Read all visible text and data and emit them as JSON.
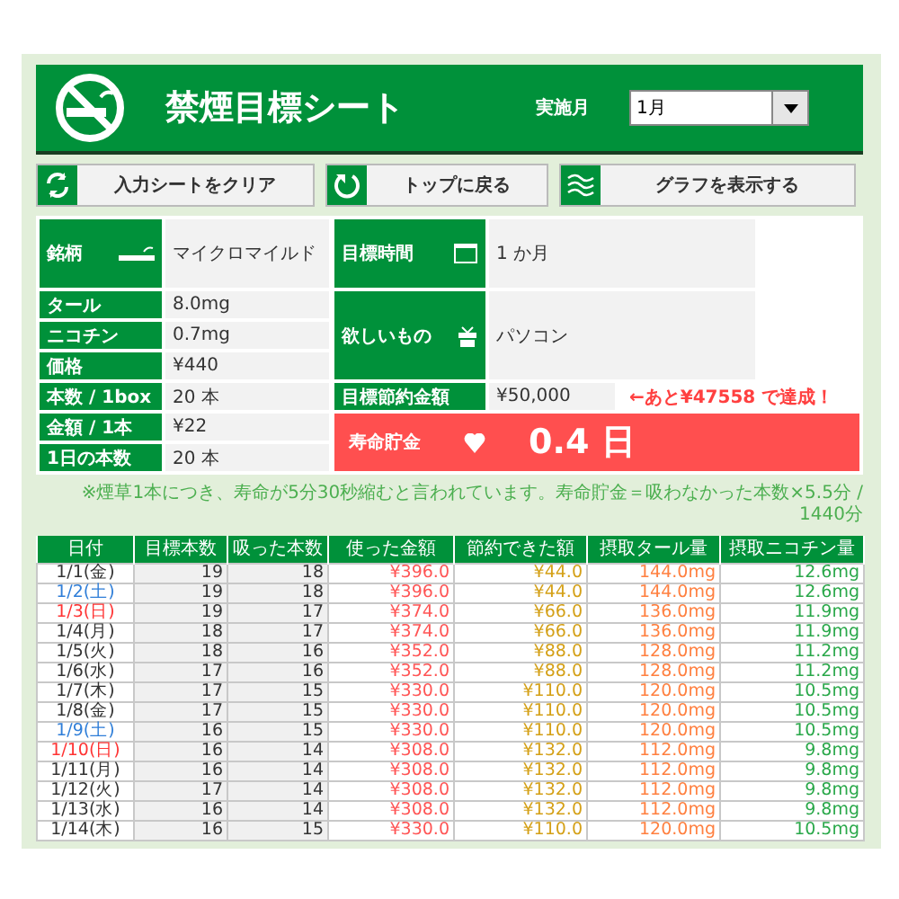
{
  "header": {
    "title": "禁煙目標シート",
    "month_label": "実施月",
    "month_value": "1月"
  },
  "buttons": [
    {
      "label": "入力シートをクリア"
    },
    {
      "label": "トップに戻る"
    },
    {
      "label": "グラフを表示する"
    }
  ],
  "profile": [
    {
      "label": "銘柄",
      "value": "マイクロマイルド"
    },
    {
      "label": "タール",
      "value": "8.0mg"
    },
    {
      "label": "ニコチン",
      "value": "0.7mg"
    },
    {
      "label": "価格",
      "value": "¥440"
    },
    {
      "label": "本数 / 1box",
      "value": "20 本"
    },
    {
      "label": "金額 / 1本",
      "value": "¥22"
    },
    {
      "label": "1日の本数",
      "value": "20 本"
    }
  ],
  "goals": {
    "period": {
      "label": "目標時間",
      "value": "1 か月"
    },
    "wish": {
      "label": "欲しいもの",
      "value": "パソコン"
    },
    "savings": {
      "label": "目標節約金額",
      "value": "¥50,000",
      "message": "←あと¥47558 で達成！"
    },
    "life": {
      "label": "寿命貯金",
      "value": "0.4 日"
    }
  },
  "note": "※煙草1本につき、寿命が5分30秒縮むと言われています。寿命貯金＝吸わなかった本数×5.5分 / 1440分",
  "table": {
    "columns": [
      "日付",
      "目標本数",
      "吸った本数",
      "使った金額",
      "節約できた額",
      "摂取タール量",
      "摂取ニコチン量"
    ],
    "rows": [
      {
        "color": "#333333",
        "cells": [
          "1/1(金)",
          "19",
          "18",
          "¥396.0",
          "¥44.0",
          "144.0mg",
          "12.6mg"
        ]
      },
      {
        "color": "#2f7ed8",
        "cells": [
          "1/2(土)",
          "19",
          "18",
          "¥396.0",
          "¥44.0",
          "144.0mg",
          "12.6mg"
        ]
      },
      {
        "color": "#ff3333",
        "cells": [
          "1/3(日)",
          "19",
          "17",
          "¥374.0",
          "¥66.0",
          "136.0mg",
          "11.9mg"
        ]
      },
      {
        "color": "#333333",
        "cells": [
          "1/4(月)",
          "18",
          "17",
          "¥374.0",
          "¥66.0",
          "136.0mg",
          "11.9mg"
        ]
      },
      {
        "color": "#333333",
        "cells": [
          "1/5(火)",
          "18",
          "16",
          "¥352.0",
          "¥88.0",
          "128.0mg",
          "11.2mg"
        ]
      },
      {
        "color": "#333333",
        "cells": [
          "1/6(水)",
          "17",
          "16",
          "¥352.0",
          "¥88.0",
          "128.0mg",
          "11.2mg"
        ]
      },
      {
        "color": "#333333",
        "cells": [
          "1/7(木)",
          "17",
          "15",
          "¥330.0",
          "¥110.0",
          "120.0mg",
          "10.5mg"
        ]
      },
      {
        "color": "#333333",
        "cells": [
          "1/8(金)",
          "17",
          "15",
          "¥330.0",
          "¥110.0",
          "120.0mg",
          "10.5mg"
        ]
      },
      {
        "color": "#2f7ed8",
        "cells": [
          "1/9(土)",
          "16",
          "15",
          "¥330.0",
          "¥110.0",
          "120.0mg",
          "10.5mg"
        ]
      },
      {
        "color": "#ff3333",
        "cells": [
          "1/10(日)",
          "16",
          "14",
          "¥308.0",
          "¥132.0",
          "112.0mg",
          "9.8mg"
        ]
      },
      {
        "color": "#333333",
        "cells": [
          "1/11(月)",
          "16",
          "14",
          "¥308.0",
          "¥132.0",
          "112.0mg",
          "9.8mg"
        ]
      },
      {
        "color": "#333333",
        "cells": [
          "1/12(火)",
          "17",
          "14",
          "¥308.0",
          "¥132.0",
          "112.0mg",
          "9.8mg"
        ]
      },
      {
        "color": "#333333",
        "cells": [
          "1/13(水)",
          "16",
          "14",
          "¥308.0",
          "¥132.0",
          "112.0mg",
          "9.8mg"
        ]
      },
      {
        "color": "#333333",
        "cells": [
          "1/14(木)",
          "16",
          "15",
          "¥330.0",
          "¥110.0",
          "120.0mg",
          "10.5mg"
        ]
      }
    ]
  }
}
